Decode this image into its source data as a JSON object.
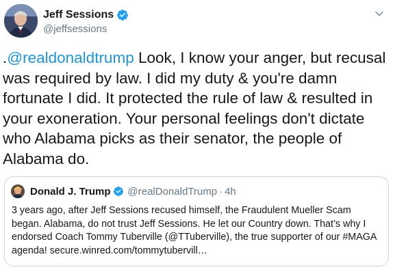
{
  "tweet": {
    "author": {
      "display_name": "Jeff Sessions",
      "handle": "@jeffsessions",
      "avatar_icon": "profile-photo"
    },
    "mention": "@realdonaldtrump",
    "text_prefix": ".",
    "text_body": " Look, I know your anger, but recusal was required by law. I did my duty & you're damn fortunate I did. It protected the rule of law & resulted in your exoneration. Your personal feelings don't dictate who Alabama picks as their senator, the people of Alabama do."
  },
  "quoted_tweet": {
    "author": {
      "display_name": "Donald J. Trump",
      "handle": "@realDonaldTrump",
      "avatar_icon": "profile-photo"
    },
    "separator": "·",
    "time": "4h",
    "text": "3 years ago, after Jeff Sessions recused himself, the Fraudulent Mueller Scam began. Alabama, do not trust Jeff Sessions. He let our Country down. That’s why I endorsed Coach Tommy Tuberville (@TTuberville), the true supporter of our #MAGA agenda! secure.winred.com/tommytubervill…"
  },
  "colors": {
    "accent": "#1b95e0",
    "verified": "#1da1f2",
    "secondary_text": "#657786",
    "border": "#ccd6dd"
  }
}
